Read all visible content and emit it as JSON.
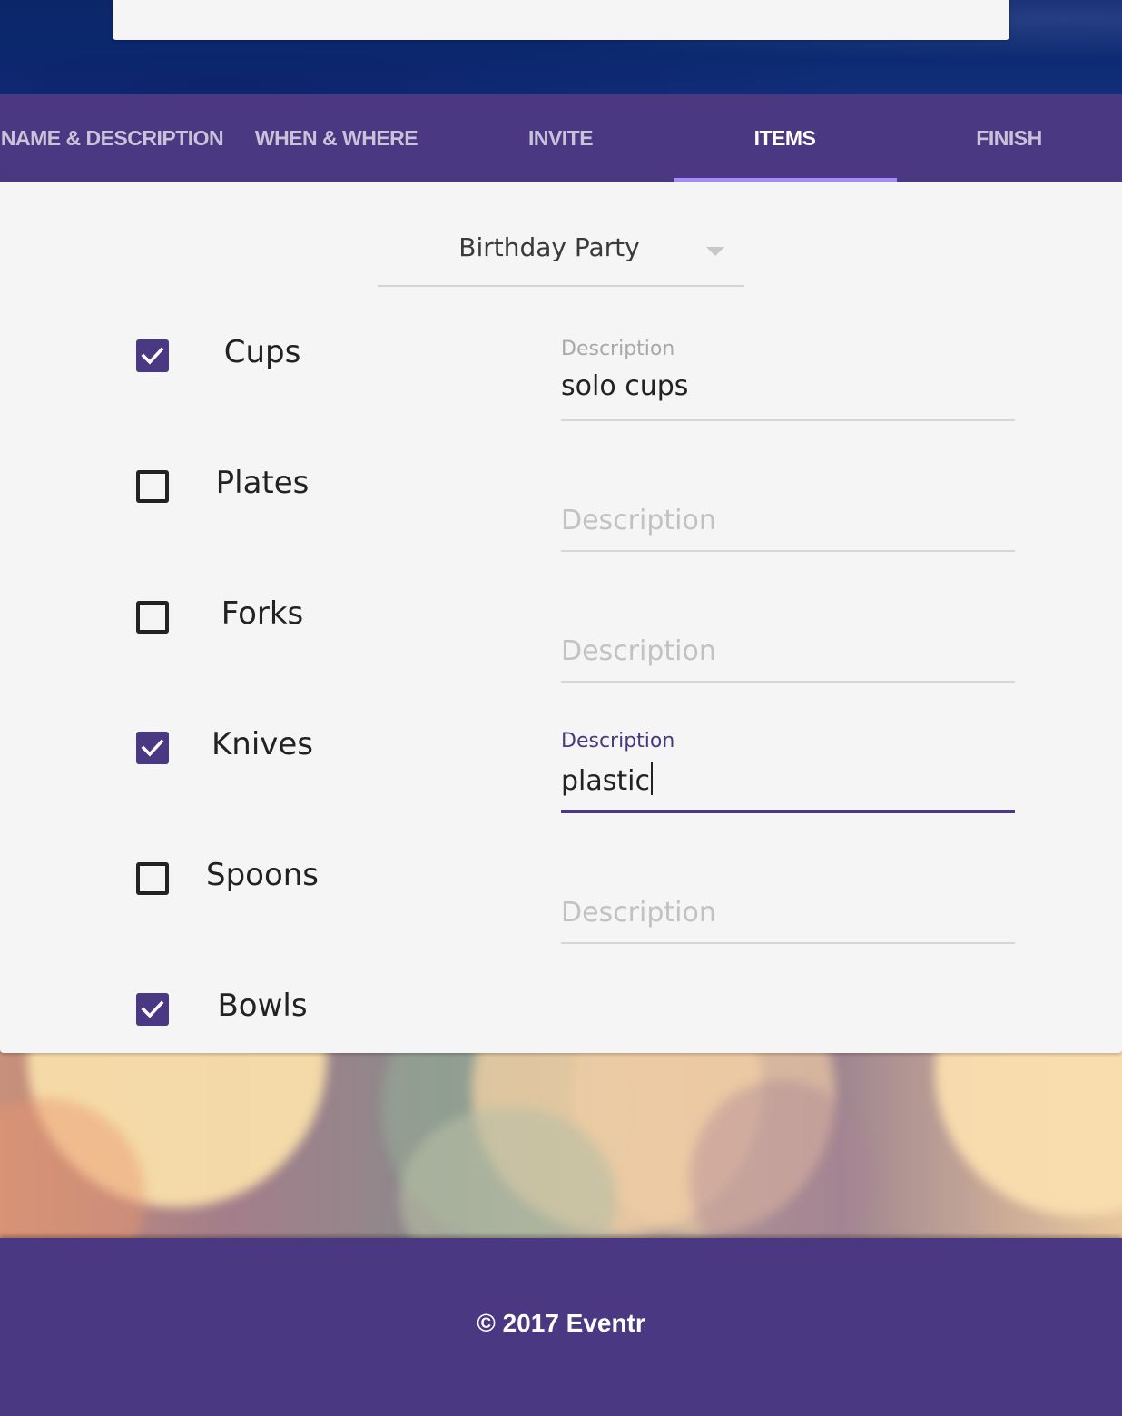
{
  "tabs": [
    {
      "label": "NAME & DESCRIPTION",
      "active": false
    },
    {
      "label": "WHEN & WHERE",
      "active": false
    },
    {
      "label": "INVITE",
      "active": false
    },
    {
      "label": "ITEMS",
      "active": true
    },
    {
      "label": "FINISH",
      "active": false
    }
  ],
  "event_select": {
    "value": "Birthday Party"
  },
  "items": [
    {
      "label": "Cups",
      "checked": true,
      "description_label": "Description",
      "description_value": "solo cups"
    },
    {
      "label": "Plates",
      "checked": false,
      "description_placeholder": "Description"
    },
    {
      "label": "Forks",
      "checked": false,
      "description_placeholder": "Description"
    },
    {
      "label": "Knives",
      "checked": true,
      "description_label": "Description",
      "description_value": "plastic",
      "focused": true
    },
    {
      "label": "Spoons",
      "checked": false,
      "description_placeholder": "Description"
    },
    {
      "label": "Bowls",
      "checked": true
    }
  ],
  "footer": {
    "text": "© 2017 Eventr"
  },
  "colors": {
    "primary": "#4a3882",
    "tab_indicator": "#a78bfa",
    "hero": "#0b2a72",
    "surface": "#f5f5f5"
  }
}
